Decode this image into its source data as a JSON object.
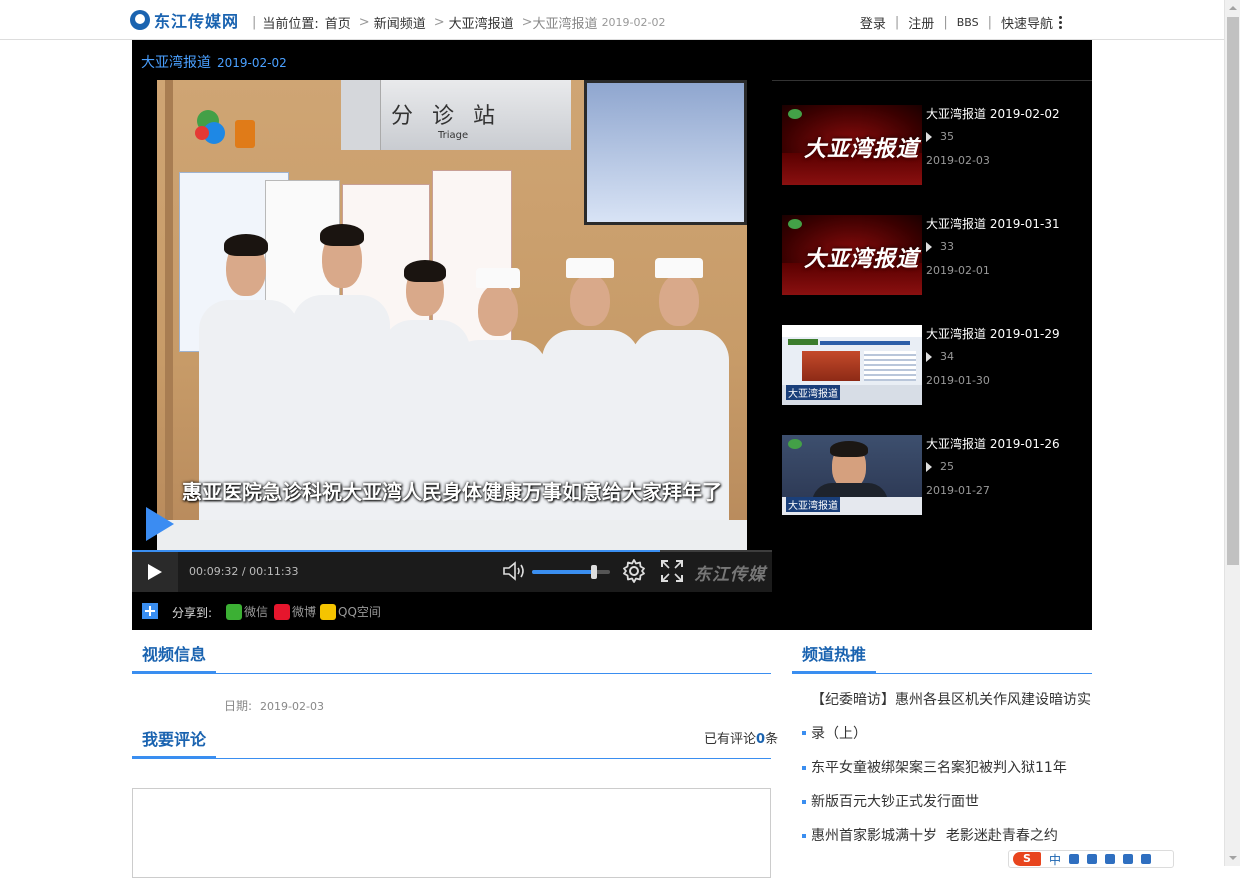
{
  "site": {
    "name": "东江传媒网"
  },
  "breadcrumb": {
    "prefix": "当前位置:",
    "items": [
      "首页",
      "新闻频道",
      "大亚湾报道"
    ],
    "current": "大亚湾报道",
    "current_date": "2019-02-02"
  },
  "topnav": {
    "login": "登录",
    "register": "注册",
    "bbs": "BBS",
    "quicknav": "快速导航"
  },
  "player": {
    "title": "大亚湾报道",
    "title_date": "2019-02-02",
    "subtitle": "惠亚医院急诊科祝大亚湾人民身体健康万事如意给大家拜年了",
    "time_current": "00:09:32",
    "time_separator": "/",
    "time_total": "00:11:33",
    "progress": 0.825,
    "volume": 0.8,
    "brand": "东江传媒",
    "scene_sign": "分 诊 站",
    "scene_sign_en": "Triage"
  },
  "share": {
    "label": "分享到:",
    "items": [
      {
        "name": "wechat",
        "label": "微信",
        "color": "#3cb034"
      },
      {
        "name": "weibo",
        "label": "微博",
        "color": "#e6162d"
      },
      {
        "name": "qzone",
        "label": "QQ空间",
        "color": "#f5c400"
      }
    ]
  },
  "playlist": [
    {
      "title": "大亚湾报道",
      "title_date": "2019-02-02",
      "views": "35",
      "date": "2019-02-03",
      "thumb_text": "大亚湾报道",
      "thumb_style": "logo"
    },
    {
      "title": "大亚湾报道",
      "title_date": "2019-01-31",
      "views": "33",
      "date": "2019-02-01",
      "thumb_text": "大亚湾报道",
      "thumb_style": "logo"
    },
    {
      "title": "大亚湾报道",
      "title_date": "2019-01-29",
      "views": "34",
      "date": "2019-01-30",
      "thumb_text": "大亚湾报道",
      "thumb_style": "web"
    },
    {
      "title": "大亚湾报道",
      "title_date": "2019-01-26",
      "views": "25",
      "date": "2019-01-27",
      "thumb_text": "大亚湾报道",
      "thumb_style": "person"
    }
  ],
  "video_info": {
    "heading": "视频信息",
    "date_label": "日期:",
    "date_value": "2019-02-03"
  },
  "comments": {
    "heading": "我要评论",
    "count_prefix": "已有评论",
    "count": "0",
    "count_suffix": "条"
  },
  "hot": {
    "heading": "频道热推",
    "items": [
      "【纪委暗访】惠州各县区机关作风建设暗访实录（上）",
      "东平女童被绑架案三名案犯被判入狱11年",
      "新版百元大钞正式发行面世",
      "惠州首家影城满十岁  老影迷赴青春之约"
    ]
  },
  "ime": {
    "lang": "中"
  },
  "colors": {
    "accent": "#3a8ef0",
    "brand": "#1a63b0",
    "panel": "#000000"
  }
}
